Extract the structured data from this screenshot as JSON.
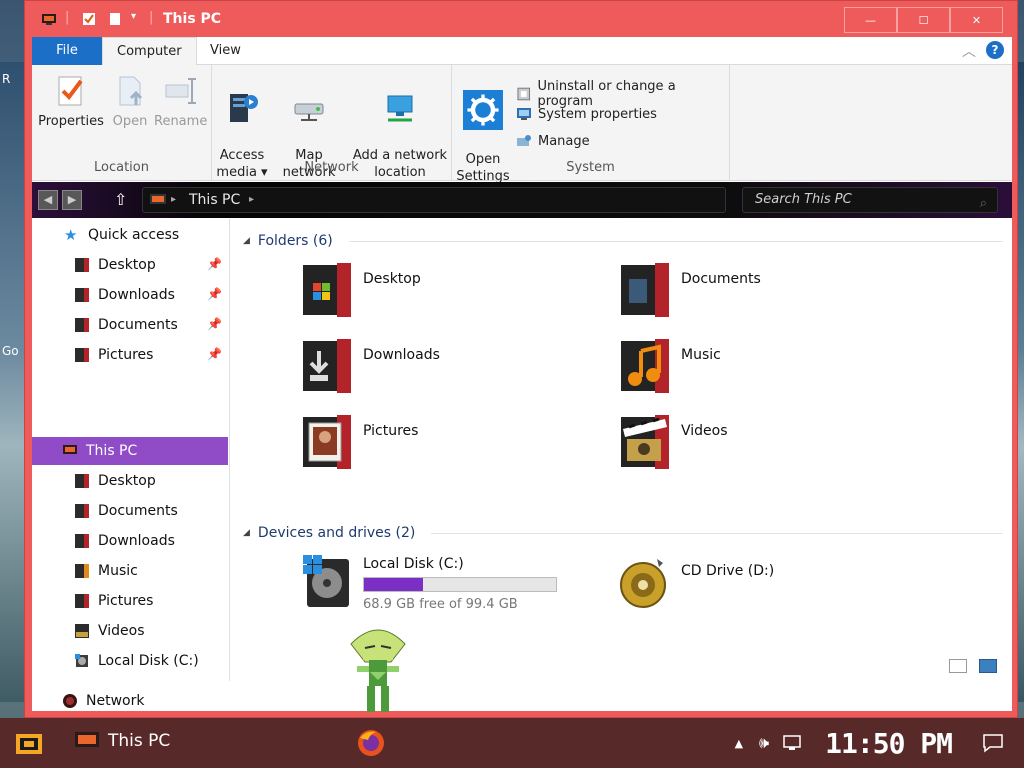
{
  "desktop": {
    "side_labels": [
      "R",
      "Go"
    ]
  },
  "window": {
    "title": "This PC",
    "minimize": "—",
    "maximize": "☐",
    "close": "✕"
  },
  "ribbon": {
    "tabs": [
      "File",
      "Computer",
      "View"
    ],
    "help_icon": "?",
    "groups": {
      "location": {
        "label": "Location",
        "buttons": [
          "Properties",
          "Open",
          "Rename"
        ]
      },
      "network": {
        "label": "Network",
        "buttons": [
          "Access\nmedia ▾",
          "Map network\ndrive ▾",
          "Add a network\nlocation"
        ]
      },
      "system": {
        "label": "System",
        "open_settings": "Open\nSettings",
        "small": [
          "Uninstall or change a program",
          "System properties",
          "Manage"
        ]
      }
    }
  },
  "address": {
    "path": "This PC",
    "search_placeholder": "Search This PC"
  },
  "nav": {
    "quick_access": "Quick access",
    "quick_items": [
      "Desktop",
      "Downloads",
      "Documents",
      "Pictures"
    ],
    "this_pc": "This PC",
    "pc_items": [
      "Desktop",
      "Documents",
      "Downloads",
      "Music",
      "Pictures",
      "Videos",
      "Local Disk (C:)"
    ],
    "network": "Network"
  },
  "main": {
    "folders_header": "Folders (6)",
    "folders": [
      "Desktop",
      "Documents",
      "Downloads",
      "Music",
      "Pictures",
      "Videos"
    ],
    "devices_header": "Devices and drives (2)",
    "drives": [
      {
        "name": "Local Disk (C:)",
        "free": "68.9 GB free of 99.4 GB",
        "used_fraction": 0.307
      },
      {
        "name": "CD Drive (D:)"
      }
    ]
  },
  "taskbar": {
    "app_label": "This PC",
    "clock": "11:50 PM"
  },
  "colors": {
    "title_accent": "#ef5a5a",
    "selection": "#8f4cc6",
    "file_tab": "#1c6fc7",
    "taskbar": "#572929"
  }
}
